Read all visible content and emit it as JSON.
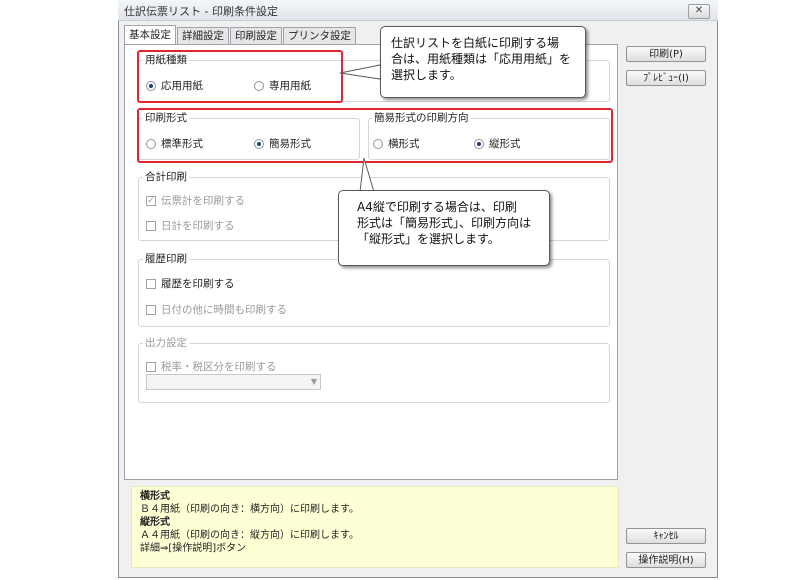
{
  "window": {
    "title": "仕訳伝票リスト - 印刷条件設定",
    "close_glyph": "✕"
  },
  "tabs": [
    {
      "label": "基本設定",
      "active": true
    },
    {
      "label": "詳細設定",
      "active": false
    },
    {
      "label": "印刷設定",
      "active": false
    },
    {
      "label": "プリンタ設定",
      "active": false
    }
  ],
  "paper_type": {
    "title": "用紙種類",
    "options": [
      {
        "label": "応用用紙",
        "checked": true
      },
      {
        "label": "専用用紙",
        "checked": false
      }
    ]
  },
  "print_format": {
    "title": "印刷形式",
    "options": [
      {
        "label": "標準形式",
        "checked": false
      },
      {
        "label": "簡易形式",
        "checked": true
      }
    ]
  },
  "print_direction": {
    "title": "簡易形式の印刷方向",
    "options": [
      {
        "label": "横形式",
        "checked": false
      },
      {
        "label": "縦形式",
        "checked": true
      }
    ]
  },
  "total_print": {
    "title": "合計印刷",
    "items": [
      {
        "label": "伝票計を印刷する",
        "checked": true,
        "enabled": false
      },
      {
        "label": "日計を印刷する",
        "checked": false,
        "enabled": false
      }
    ]
  },
  "history_print": {
    "title": "履歴印刷",
    "items": [
      {
        "label": "履歴を印刷する",
        "checked": false,
        "enabled": true
      },
      {
        "label": "日付の他に時間も印刷する",
        "checked": false,
        "enabled": false
      }
    ]
  },
  "output_settings": {
    "title": "出力設定",
    "items": [
      {
        "label": "税率・税区分を印刷する",
        "checked": false,
        "enabled": false
      }
    ],
    "combo_value": "",
    "combo_arrow": "▼"
  },
  "callouts": {
    "top_lines": [
      "仕訳リストを白紙に印刷する場",
      "合は、用紙種類は「応用用紙」を",
      "選択します。"
    ],
    "bottom_lines": [
      "A4縦で印刷する場合は、印刷",
      "形式は「簡易形式」、印刷方向は",
      "「縦形式」を選択します。"
    ]
  },
  "buttons": {
    "print": "印刷(P)",
    "preview": "ﾌﾟﾚﾋﾞｭｰ(I)",
    "cancel": "ｷｬﾝｾﾙ",
    "help": "操作説明(H)"
  },
  "info_panel": {
    "heading1": "横形式",
    "line1": "Ｂ４用紙（印刷の向き：横方向）に印刷します。",
    "heading2": "縦形式",
    "line2": "Ａ４用紙（印刷の向き：縦方向）に印刷します。",
    "link": "詳細⇒[操作説明]ボタン"
  },
  "colors": {
    "highlight": "#e0262e",
    "info_bg": "#ffffd6",
    "radio_fill": "#1f3f7a"
  }
}
